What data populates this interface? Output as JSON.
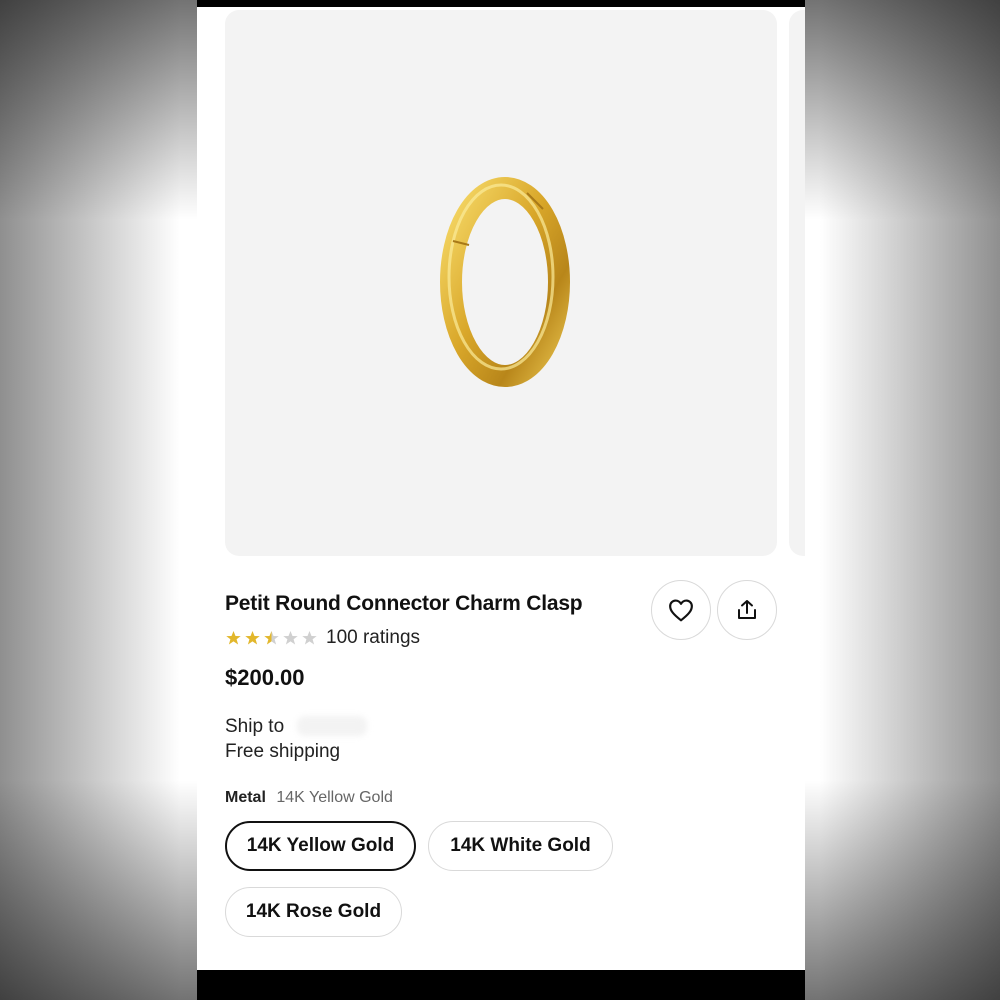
{
  "product": {
    "title": "Petit Round Connector Charm Clasp",
    "rating": 2.5,
    "rating_max": 5,
    "ratings_count_label": "100 ratings",
    "price": "$200.00"
  },
  "shipping": {
    "ship_to_label": "Ship to",
    "free_shipping_label": "Free shipping"
  },
  "variant": {
    "label": "Metal",
    "selected_value": "14K Yellow Gold",
    "options": [
      "14K Yellow Gold",
      "14K White Gold",
      "14K Rose Gold"
    ]
  },
  "icons": {
    "favorite": "heart-icon",
    "share": "share-icon",
    "star_filled": "star-icon"
  },
  "colors": {
    "star_filled": "#e2b72c",
    "star_empty": "#d0d0d0",
    "gold": "#d8a92a",
    "selected_border": "#111111"
  }
}
